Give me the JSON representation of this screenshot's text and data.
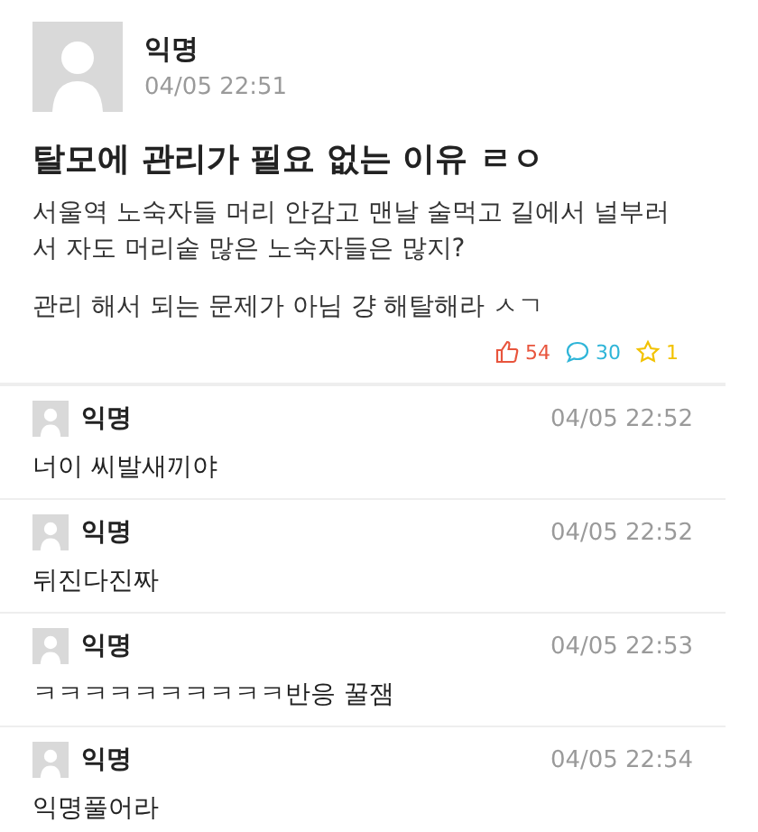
{
  "post": {
    "author": "익명",
    "time": "04/05 22:51",
    "title": "탈모에 관리가 필요 없는 이유 ㄹㅇ",
    "paragraphs": [
      "서울역 노숙자들 머리 안감고 맨날 술먹고 길에서 널부러서 자도 머리숱 많은 노숙자들은 많지?",
      "관리 해서 되는 문제가 아님 걍 해탈해라 ㅅㄱ"
    ],
    "stats": [
      {
        "kind": "like",
        "count": "54"
      },
      {
        "kind": "comment",
        "count": "30"
      },
      {
        "kind": "scrap",
        "count": "1"
      }
    ]
  },
  "comments": [
    {
      "author": "익명",
      "time": "04/05 22:52",
      "text": "너이 씨발새끼야"
    },
    {
      "author": "익명",
      "time": "04/05 22:52",
      "text": "뒤진다진짜"
    },
    {
      "author": "익명",
      "time": "04/05 22:53",
      "text": "ㅋㅋㅋㅋㅋㅋㅋㅋㅋㅋ반응 꿀잼"
    },
    {
      "author": "익명",
      "time": "04/05 22:54",
      "text": "익명풀어라"
    }
  ]
}
